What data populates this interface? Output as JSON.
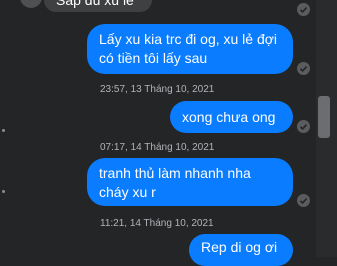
{
  "conversation": {
    "messages": [
      {
        "text": "Sắp đủ xu lẻ",
        "direction": "received"
      },
      {
        "text": "Lấy xu kia trc đi og, xu lẻ đợi có tiền tôi lấy sau",
        "direction": "sent"
      },
      {
        "text": "xong chưa ong",
        "direction": "sent"
      },
      {
        "text": "tranh thủ làm nhanh nha cháy xu r",
        "direction": "sent"
      },
      {
        "text": "Rep di og ơi",
        "direction": "sent"
      }
    ],
    "timestamps": [
      "23:57, 13 Tháng 10, 2021",
      "07:17, 14 Tháng 10, 2021",
      "11:21, 14 Tháng 10, 2021"
    ]
  },
  "colors": {
    "background": "#242526",
    "sent_bubble": "#0a7cff",
    "received_bubble": "#3e4042",
    "timestamp_text": "#b0b3b8"
  },
  "icons": [
    "avatar",
    "seen-check-icon",
    "scrollbar"
  ]
}
